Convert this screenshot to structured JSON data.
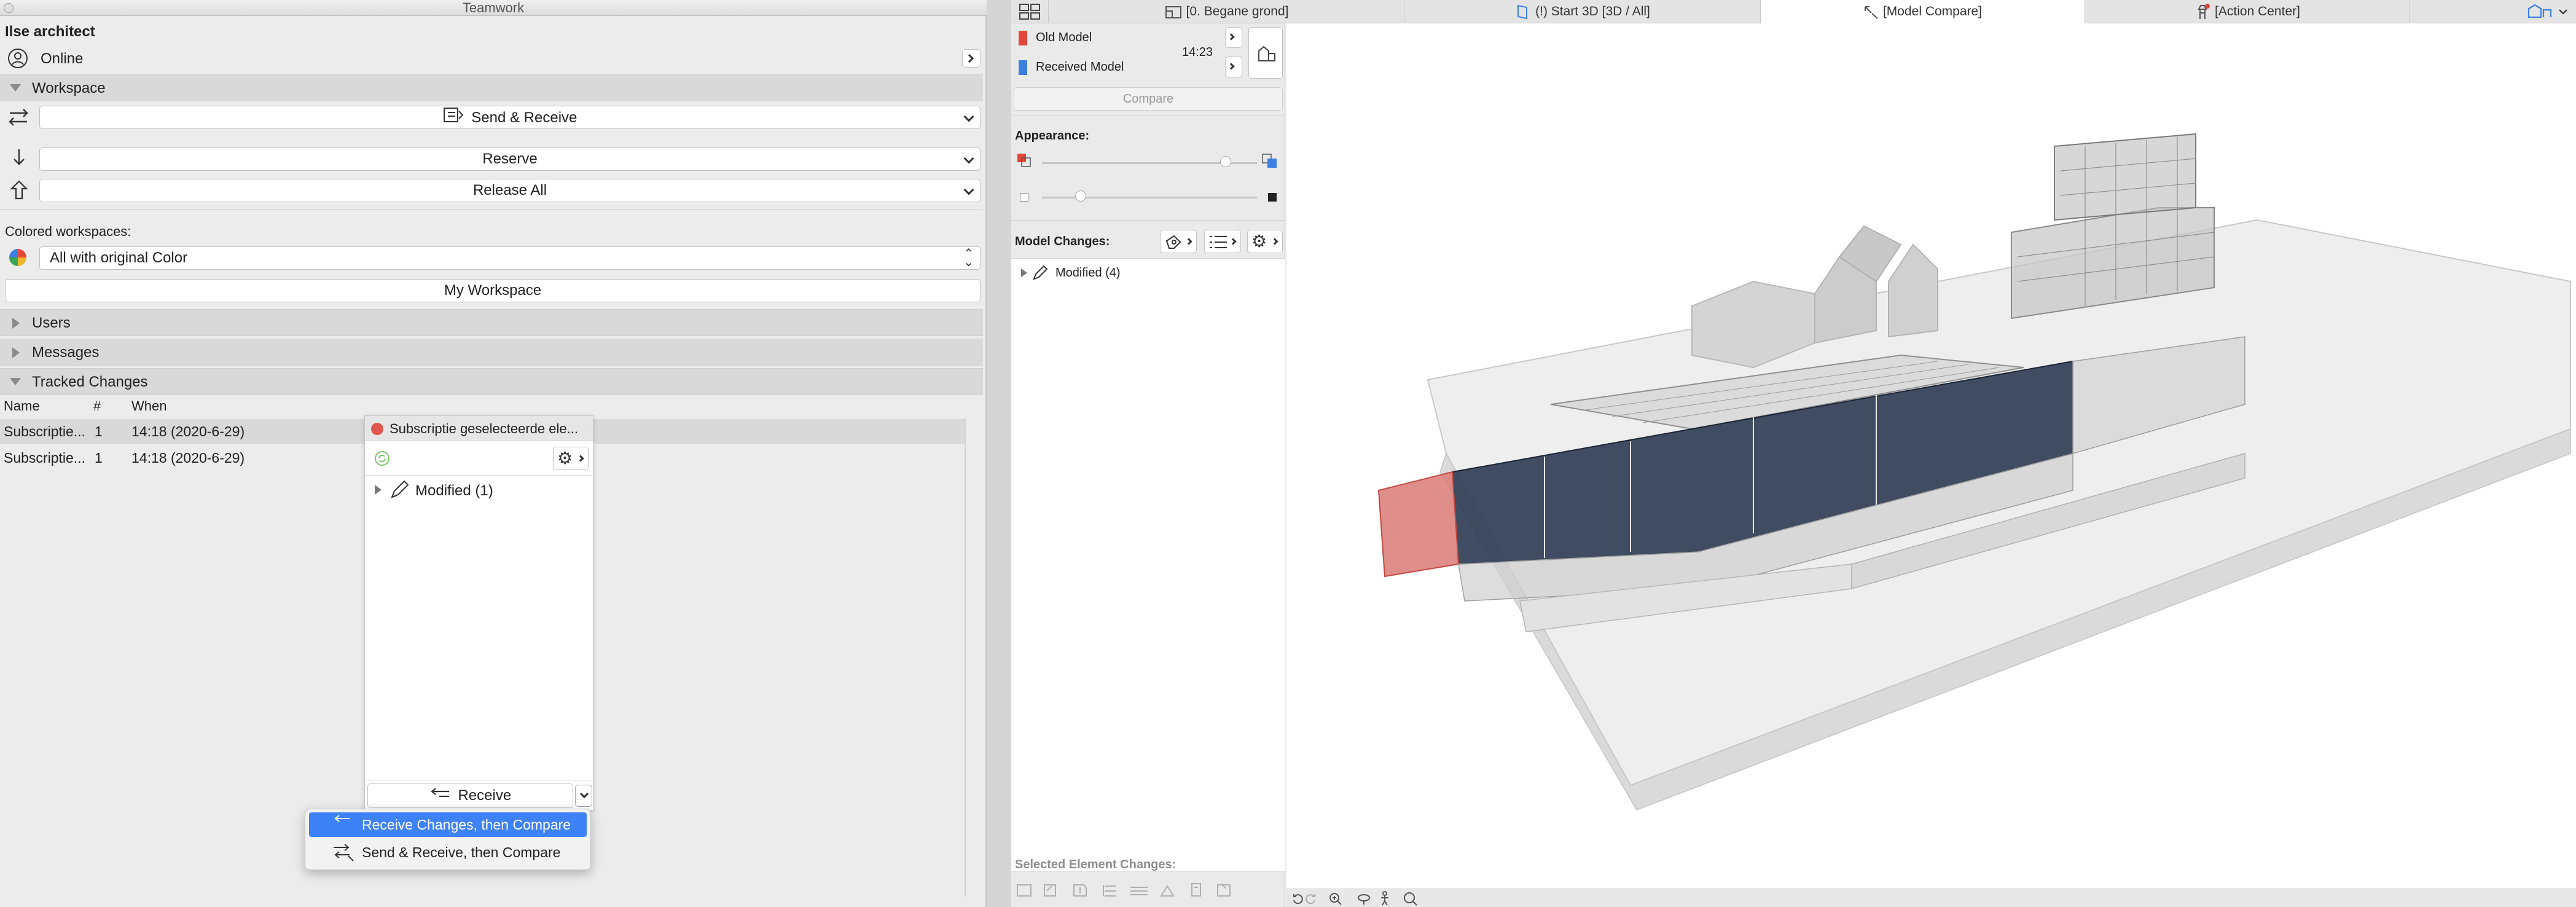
{
  "teamwork": {
    "window_title": "Teamwork",
    "user_name": "Ilse architect",
    "status": "Online",
    "workspace_header": "Workspace",
    "send_receive_label": "Send & Receive",
    "reserve_label": "Reserve",
    "release_all_label": "Release All",
    "colored_workspaces_label": "Colored workspaces:",
    "color_option": "All with original Color",
    "my_workspace_label": "My Workspace",
    "users_header": "Users",
    "messages_header": "Messages",
    "tracked_changes_header": "Tracked Changes",
    "table": {
      "columns": [
        "Name",
        "#",
        "When"
      ],
      "rows": [
        {
          "name": "Subscriptie...",
          "count": "1",
          "when": "14:18 (2020-6-29)"
        },
        {
          "name": "Subscriptie...",
          "count": "1",
          "when": "14:18 (2020-6-29)"
        }
      ]
    },
    "popover": {
      "title": "Subscriptie geselecteerde ele...",
      "tree_item": "Modified (1)",
      "receive_label": "Receive"
    },
    "menu": {
      "items": [
        "Receive Changes, then Compare",
        "Send & Receive, then Compare"
      ]
    }
  },
  "tabs": [
    {
      "label": "[0. Begane grond]",
      "icon": "floor-plan-icon"
    },
    {
      "label": "(!) Start 3D [3D / All]",
      "icon": "3d-window-icon"
    },
    {
      "label": "[Model Compare]",
      "icon": "model-compare-icon"
    },
    {
      "label": "[Action Center]",
      "icon": "action-center-icon"
    }
  ],
  "model_compare": {
    "old_model_label": "Old Model",
    "received_model_label": "Received Model",
    "time": "14:23",
    "compare_label": "Compare",
    "appearance_label": "Appearance:",
    "model_changes_label": "Model Changes:",
    "tree_item": "Modified (4)",
    "selected_changes_label": "Selected Element Changes:",
    "old_color": "#e0463a",
    "new_color": "#3d7fe0"
  },
  "colors": {
    "accent": "#3e82f7",
    "status_dot": "#e0564c",
    "building_highlight_old": "#d97a75",
    "building_highlight_new": "#2b3a52"
  }
}
